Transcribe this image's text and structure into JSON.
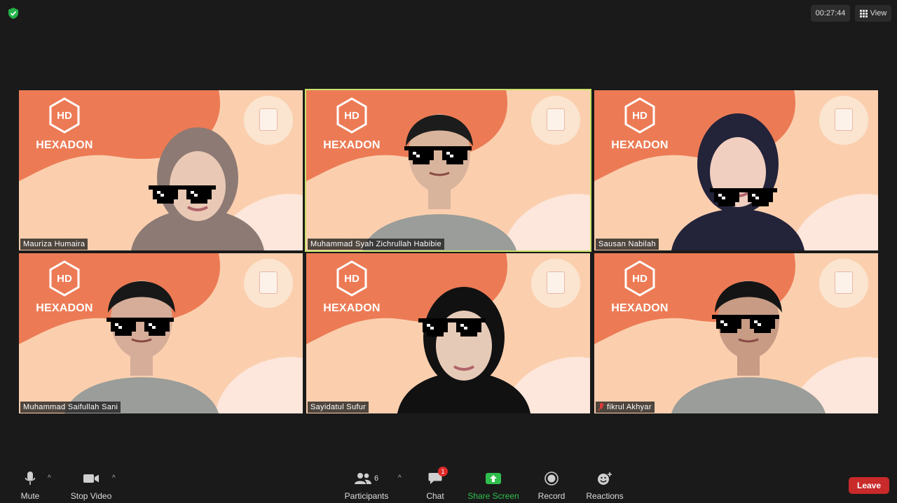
{
  "meeting": {
    "timer": "00:27:44",
    "view_label": "View"
  },
  "tiles": [
    {
      "name": "Mauriza Humaira",
      "brand": "HEXADON",
      "logo": "HD",
      "active": false,
      "muted": false
    },
    {
      "name": "Muhammad Syah Zichrullah Habibie",
      "brand": "HEXADON",
      "logo": "HD",
      "active": true,
      "muted": false
    },
    {
      "name": "Sausan Nabilah",
      "brand": "HEXADON",
      "logo": "HD",
      "active": false,
      "muted": false
    },
    {
      "name": "Muhammad Saifullah Sani",
      "brand": "HEXADON",
      "logo": "HD",
      "active": false,
      "muted": false
    },
    {
      "name": "Sayidatul Sufur",
      "brand": "HEXADON",
      "logo": "HD",
      "active": false,
      "muted": false
    },
    {
      "name": "fikrul Akhyar",
      "brand": "HEXADON",
      "logo": "HD",
      "active": false,
      "muted": true
    }
  ],
  "toolbar": {
    "mute_label": "Mute",
    "video_label": "Stop Video",
    "participants_label": "Participants",
    "participants_count": "6",
    "chat_label": "Chat",
    "chat_badge": "1",
    "share_label": "Share Screen",
    "record_label": "Record",
    "reactions_label": "Reactions",
    "leave_label": "Leave"
  },
  "colors": {
    "background": "#1a1a1a",
    "tile_peach": "#fbcfae",
    "tile_orange": "#ec7b55",
    "active_border": "#c9e26a",
    "share_green": "#2fbf4c",
    "leave_red": "#c92a2a",
    "chat_badge_red": "#e02828"
  }
}
